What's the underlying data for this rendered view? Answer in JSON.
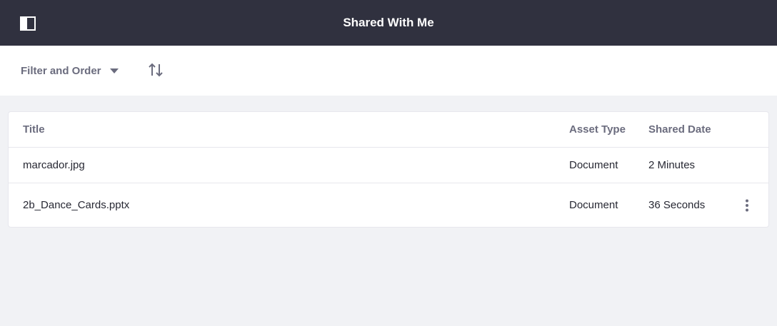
{
  "header": {
    "title": "Shared With Me",
    "sidebar_toggle_icon": "sidebar-panel-icon"
  },
  "toolbar": {
    "filter_label": "Filter and Order",
    "filter_icon": "caret-down-icon",
    "order_icon": "sort-order-icon"
  },
  "table": {
    "columns": [
      "Title",
      "Asset Type",
      "Shared Date"
    ],
    "rows": [
      {
        "title": "marcador.jpg",
        "asset_type": "Document",
        "shared_date": "2 Minutes",
        "actions_visible": false
      },
      {
        "title": "2b_Dance_Cards.pptx",
        "asset_type": "Document",
        "shared_date": "36 Seconds",
        "actions_visible": true
      }
    ]
  },
  "colors": {
    "topbar": "#30313f",
    "background": "#f1f2f5",
    "muted_text": "#6b6c7e",
    "text": "#272833",
    "border": "#e7e7ed"
  }
}
